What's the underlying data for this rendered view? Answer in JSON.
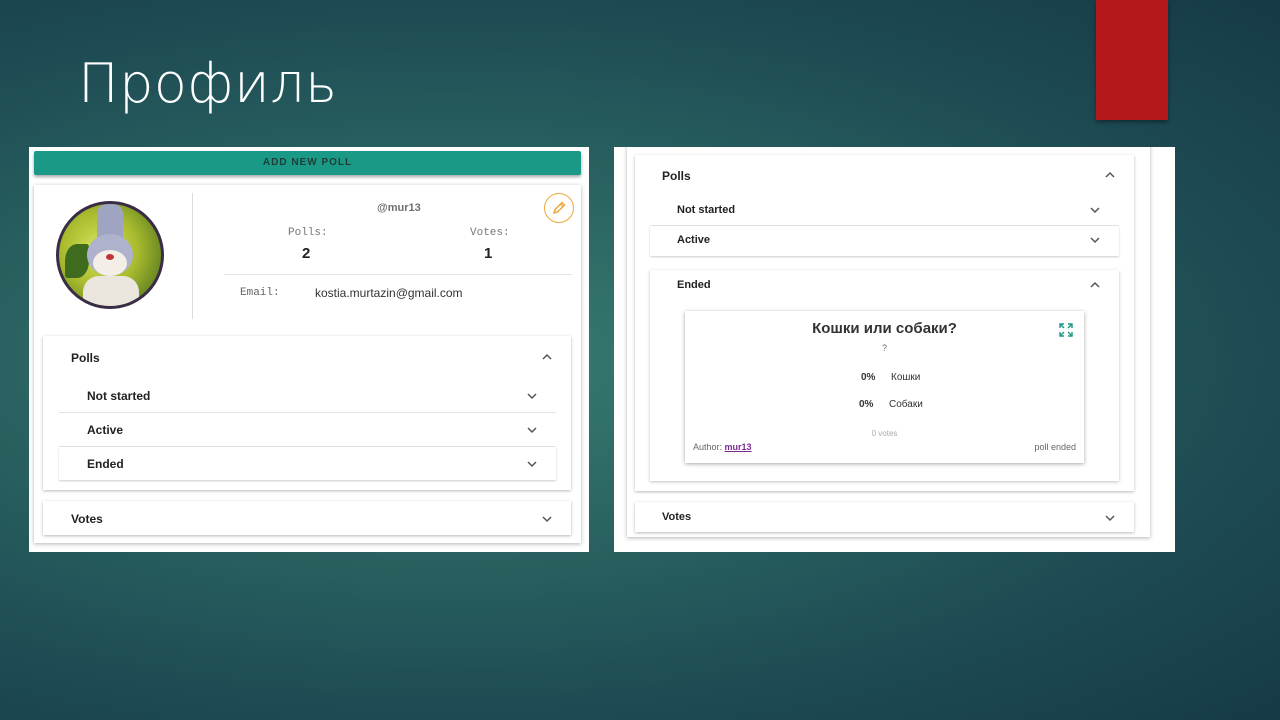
{
  "slide": {
    "title": "Профиль",
    "accent_color": "#b3171a"
  },
  "left_screenshot": {
    "add_button_label": "ADD NEW POLL",
    "profile": {
      "username": "@mur13",
      "polls_label": "Polls:",
      "polls_count": "2",
      "votes_label": "Votes:",
      "votes_count": "1",
      "email_label": "Email:",
      "email_value": "kostia.murtazin@gmail.com",
      "edit_icon": "pencil-icon"
    },
    "polls_section": {
      "title": "Polls",
      "subsections": [
        {
          "label": "Not started"
        },
        {
          "label": "Active"
        },
        {
          "label": "Ended"
        }
      ]
    },
    "votes_section": {
      "title": "Votes"
    }
  },
  "right_screenshot": {
    "polls_section": {
      "title": "Polls",
      "subsections": [
        {
          "label": "Not started"
        },
        {
          "label": "Active"
        },
        {
          "label": "Ended"
        }
      ]
    },
    "poll_card": {
      "title": "Кошки или собаки?",
      "description": "?",
      "options": [
        {
          "percent": "0%",
          "name": "Кошки"
        },
        {
          "percent": "0%",
          "name": "Собаки"
        }
      ],
      "votes_text": "0 votes",
      "author_prefix": "Author:",
      "author_name": "mur13",
      "status": "poll ended"
    },
    "votes_section": {
      "title": "Votes"
    }
  },
  "colors": {
    "primary_button": "#1a9a86",
    "edit_accent": "#f0a83a",
    "author_link": "#7b2b90"
  }
}
